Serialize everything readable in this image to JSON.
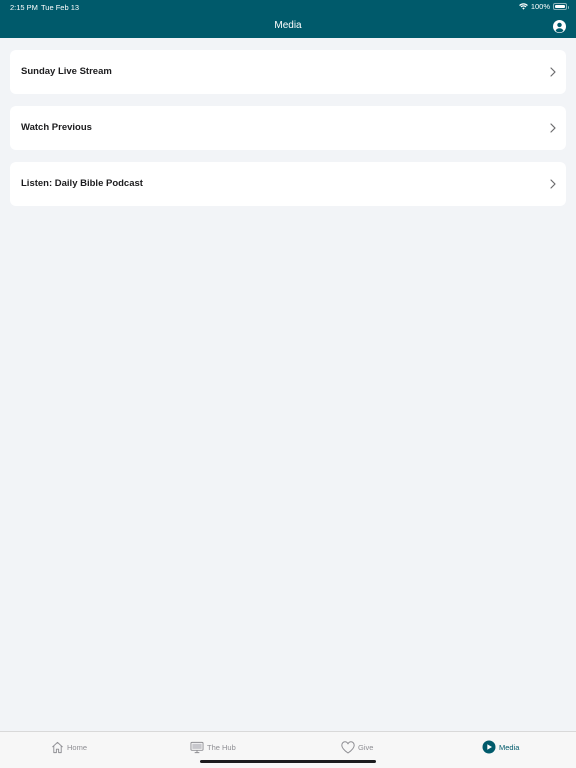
{
  "status_bar": {
    "time": "2:15 PM",
    "date": "Tue Feb 13",
    "battery": "100%",
    "icons": [
      "wifi-icon",
      "battery-icon"
    ]
  },
  "header": {
    "title": "Media",
    "background": "#005a6b",
    "account_icon": "account-circle-icon"
  },
  "media_items": [
    {
      "label": "Sunday Live Stream"
    },
    {
      "label": "Watch Previous"
    },
    {
      "label": "Listen: Daily Bible Podcast"
    }
  ],
  "tab_bar": {
    "active_color": "#005a6b",
    "tabs": [
      {
        "label": "Home",
        "icon": "home-icon",
        "active": false
      },
      {
        "label": "The Hub",
        "icon": "monitor-icon",
        "active": false
      },
      {
        "label": "Give",
        "icon": "heart-icon",
        "active": false
      },
      {
        "label": "Media",
        "icon": "play-circle-icon",
        "active": true
      }
    ]
  }
}
